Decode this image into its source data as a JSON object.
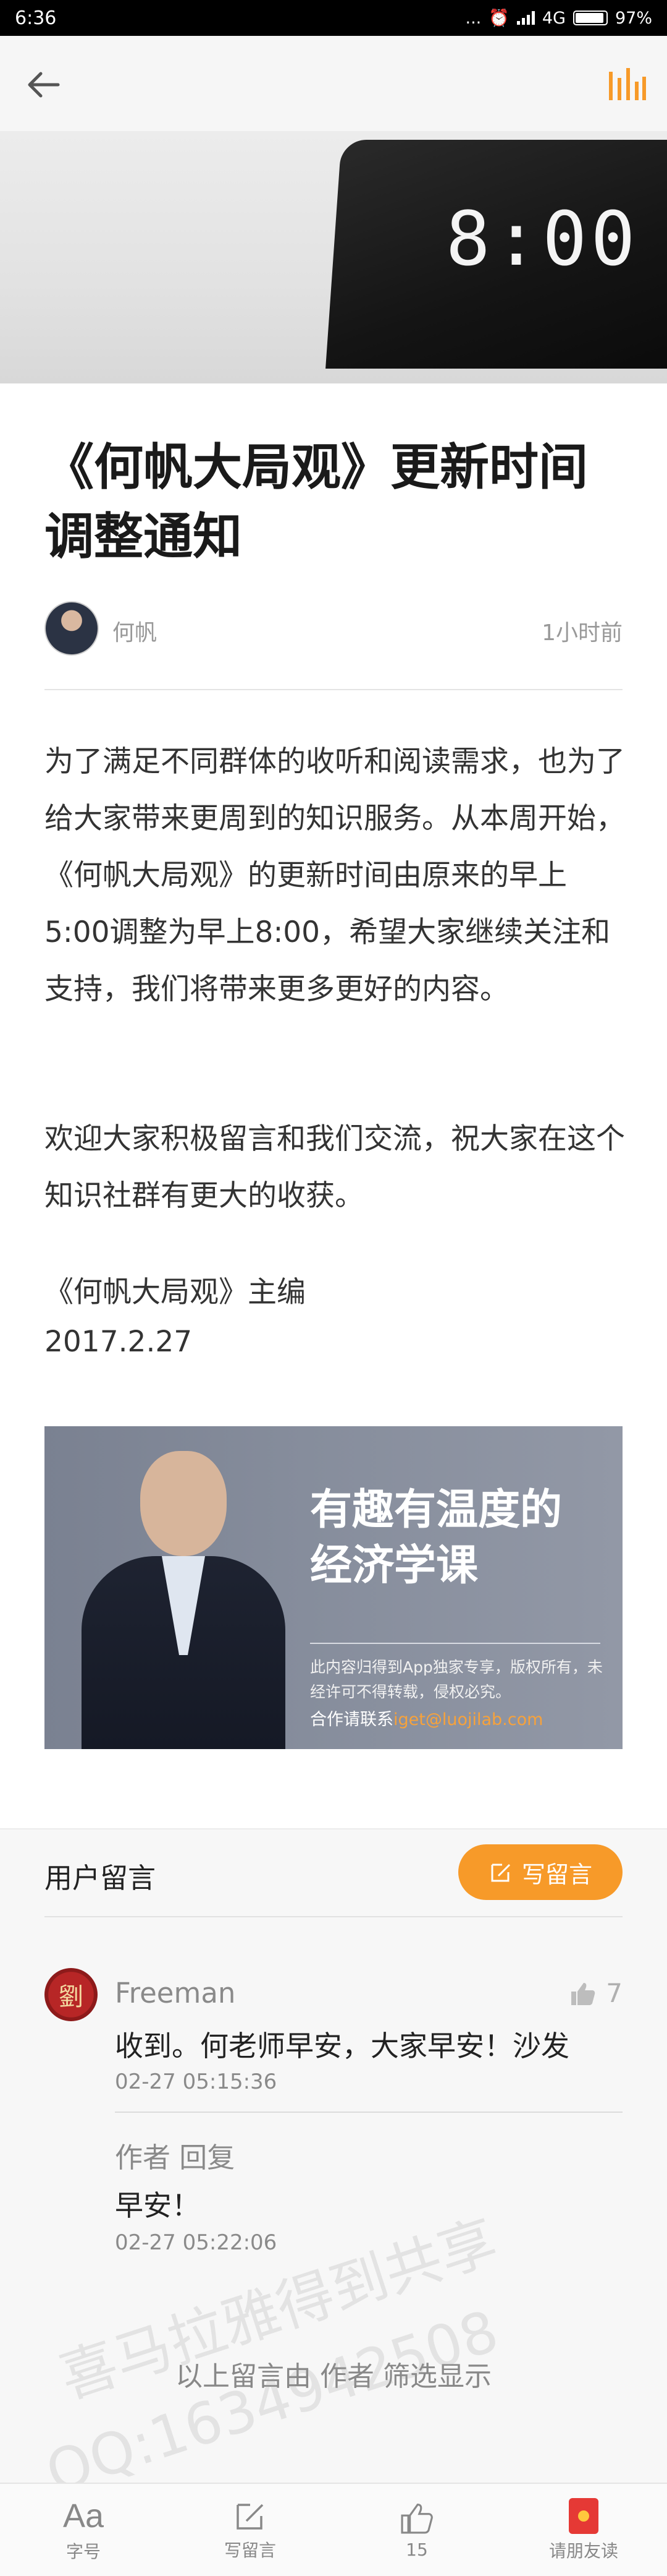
{
  "status_bar": {
    "time": "6:36",
    "dots": "...",
    "network": "4G",
    "battery": "97%"
  },
  "article": {
    "title": "《何帆大局观》更新时间调整通知",
    "author": "何帆",
    "posted": "1小时前",
    "hero_clock": "8:00",
    "paragraph1": "为了满足不同群体的收听和阅读需求，也为了给大家带来更周到的知识服务。从本周开始，《何帆大局观》的更新时间由原来的早上5:00调整为早上8:00，希望大家继续关注和支持，我们将带来更多更好的内容。",
    "paragraph2": "欢迎大家积极留言和我们交流，祝大家在这个知识社群有更大的收获。",
    "signature": "《何帆大局观》主编",
    "date": "2017.2.27"
  },
  "banner": {
    "headline_line1": "有趣有温度的",
    "headline_line2": "经济学课",
    "notice": "此内容归得到App独家专享，版权所有，未经许可不得转载，侵权必究。",
    "contact_prefix": "合作请联系",
    "contact_email": "iget@luojilab.com"
  },
  "comments": {
    "header": "用户留言",
    "write_label": "写留言",
    "items": [
      {
        "avatar_text": "劉",
        "user": "Freeman",
        "likes": "7",
        "text": "收到。何老师早安，大家早安！沙发",
        "time": "02-27 05:15:36",
        "reply_author": "作者 回复",
        "reply_text": "早安！",
        "reply_time": "02-27 05:22:06"
      }
    ],
    "filter_note": "以上留言由 作者 筛选显示"
  },
  "bottom_bar": {
    "font_icon_text": "Aa",
    "font_label": "字号",
    "write_label": "写留言",
    "like_count": "15",
    "invite_label": "请朋友读"
  },
  "watermark": {
    "line1": "喜马拉雅得到共享",
    "line2": "QQ:1634942508"
  },
  "colors": {
    "accent": "#f79a29",
    "status_bar": "#000000"
  },
  "icons": [
    "back-arrow-icon",
    "audio-bars-icon",
    "edit-icon",
    "thumb-up-icon",
    "red-packet-icon"
  ]
}
